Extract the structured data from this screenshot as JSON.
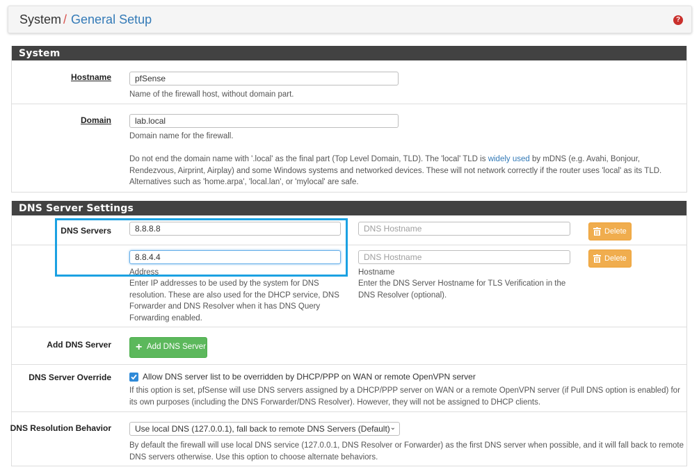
{
  "breadcrumb": {
    "root": "System",
    "separator": "/",
    "current": "General Setup"
  },
  "help_icon": {
    "icon": "question-circle-icon",
    "glyph": "?"
  },
  "system_panel": {
    "title": "System",
    "hostname": {
      "label": "Hostname",
      "value": "pfSense",
      "help": "Name of the firewall host, without domain part."
    },
    "domain": {
      "label": "Domain",
      "value": "lab.local",
      "help": "Domain name for the firewall.",
      "note_before_link": "Do not end the domain name with '.local' as the final part (Top Level Domain, TLD). The 'local' TLD is ",
      "note_link": "widely used",
      "note_after_link": " by mDNS (e.g. Avahi, Bonjour, Rendezvous, Airprint, Airplay) and some Windows systems and networked devices. These will not network correctly if the router uses 'local' as its TLD. Alternatives such as 'home.arpa', 'local.lan', or 'mylocal' are safe."
    }
  },
  "dns_panel": {
    "title": "DNS Server Settings",
    "servers_label": "DNS Servers",
    "servers": [
      {
        "address": "8.8.8.8",
        "hostname_placeholder": "DNS Hostname",
        "delete_label": "Delete"
      },
      {
        "address": "8.8.4.4",
        "hostname_placeholder": "DNS Hostname",
        "delete_label": "Delete"
      }
    ],
    "address_caption": "Address",
    "address_help": "Enter IP addresses to be used by the system for DNS resolution. These are also used for the DHCP service, DNS Forwarder and DNS Resolver when it has DNS Query Forwarding enabled.",
    "hostname_caption": "Hostname",
    "hostname_help": "Enter the DNS Server Hostname for TLS Verification in the DNS Resolver (optional).",
    "add": {
      "label": "Add DNS Server",
      "button": "Add DNS Server"
    },
    "override": {
      "label": "DNS Server Override",
      "checked": true,
      "checkbox_text": "Allow DNS server list to be overridden by DHCP/PPP on WAN or remote OpenVPN server",
      "help": "If this option is set, pfSense will use DNS servers assigned by a DHCP/PPP server on WAN or a remote OpenVPN server (if Pull DNS option is enabled) for its own purposes (including the DNS Forwarder/DNS Resolver). However, they will not be assigned to DHCP clients."
    },
    "resolution": {
      "label": "DNS Resolution Behavior",
      "selected": "Use local DNS (127.0.0.1), fall back to remote DNS Servers (Default)",
      "help": "By default the firewall will use local DNS service (127.0.0.1, DNS Resolver or Forwarder) as the first DNS server when possible, and it will fall back to remote DNS servers otherwise. Use this option to choose alternate behaviors."
    }
  },
  "colors": {
    "heading_bg": "#424242",
    "link": "#337ab7",
    "delete": "#f0ad4e",
    "add": "#5cb85c",
    "highlight": "#1ba1e2"
  }
}
